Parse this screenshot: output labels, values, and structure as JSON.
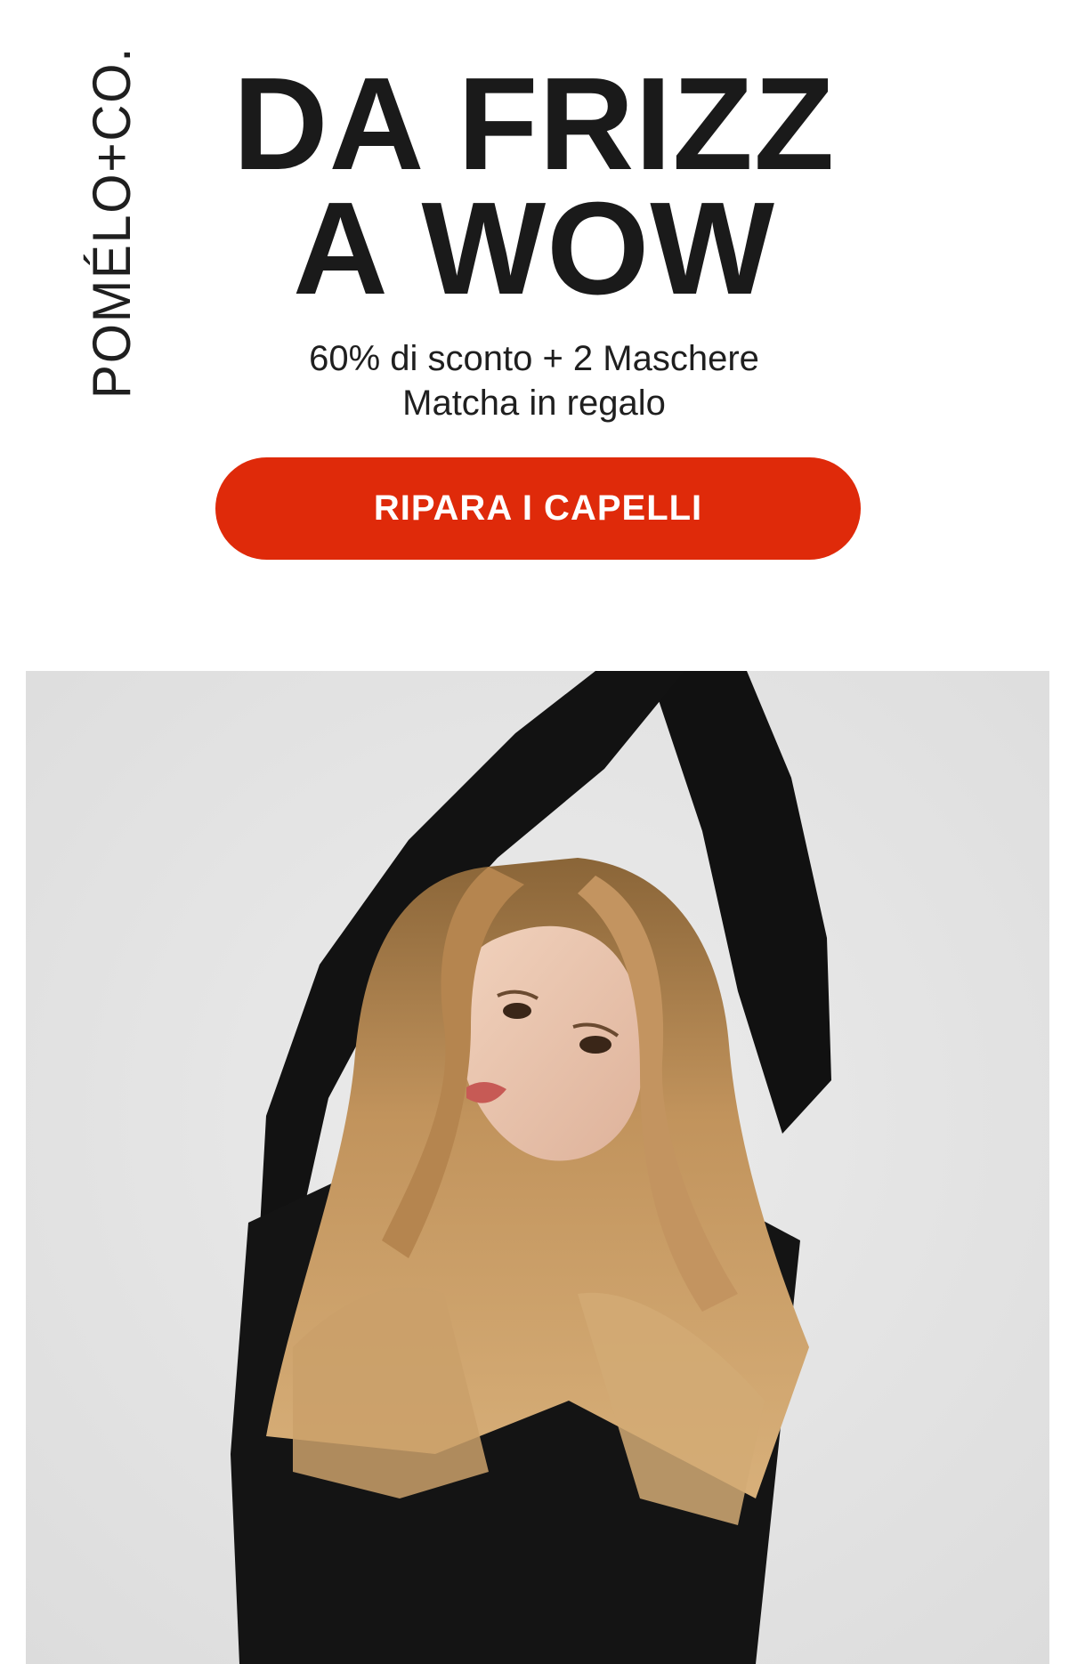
{
  "brand": {
    "logo_text": "POMÉLO+CO."
  },
  "hero": {
    "headline_line1": "DA FRIZZ",
    "headline_line2": "A WOW",
    "subtitle_line1": "60% di sconto + 2 Maschere",
    "subtitle_line2": "Matcha in regalo",
    "cta_label": "RIPARA I CAPELLI"
  },
  "colors": {
    "cta_background": "#df2a0a",
    "cta_text": "#ffffff",
    "headline": "#1a1a1a",
    "photo_background": "#e3e3e3"
  },
  "photo": {
    "icon": "model-portrait-image"
  }
}
